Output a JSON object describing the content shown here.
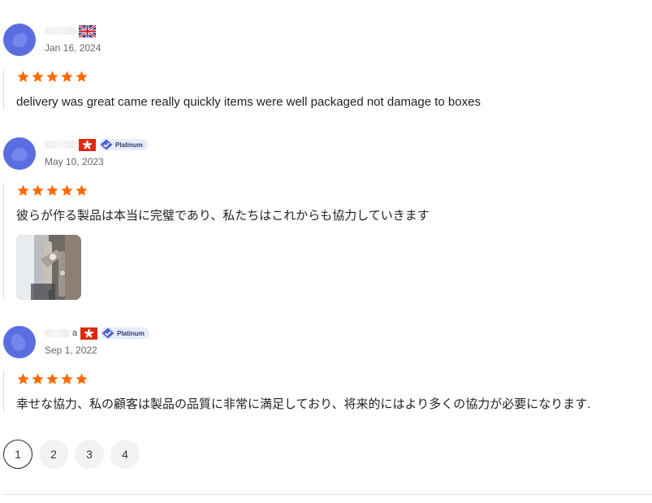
{
  "colors": {
    "star": "#ff6a00",
    "avatar": "#5b6ee1",
    "badge_bg": "#e6ecfb",
    "badge_icon": "#4a63d6"
  },
  "reviews": [
    {
      "name_suffix": "",
      "flag": "uk-flag-icon",
      "badge": "",
      "date": "Jan 16, 2024",
      "rating": 5,
      "text": "delivery was great came really quickly items were well packaged not damage to boxes",
      "has_photo": false
    },
    {
      "name_suffix": "",
      "flag": "hong-kong-flag-icon",
      "badge": "Platinum",
      "date": "May 10, 2023",
      "rating": 5,
      "text": "彼らが作る製品は本当に完璧であり、私たちはこれからも協力していきます",
      "has_photo": true
    },
    {
      "name_suffix": "a",
      "flag": "hong-kong-flag-icon",
      "badge": "Platinum",
      "date": "Sep 1, 2022",
      "rating": 5,
      "text": "幸せな協力、私の顧客は製品の品質に非常に満足しており、将来的にはより多くの協力が必要になります.",
      "has_photo": false
    }
  ],
  "pagination": {
    "pages": [
      "1",
      "2",
      "3",
      "4"
    ],
    "current": "1"
  }
}
